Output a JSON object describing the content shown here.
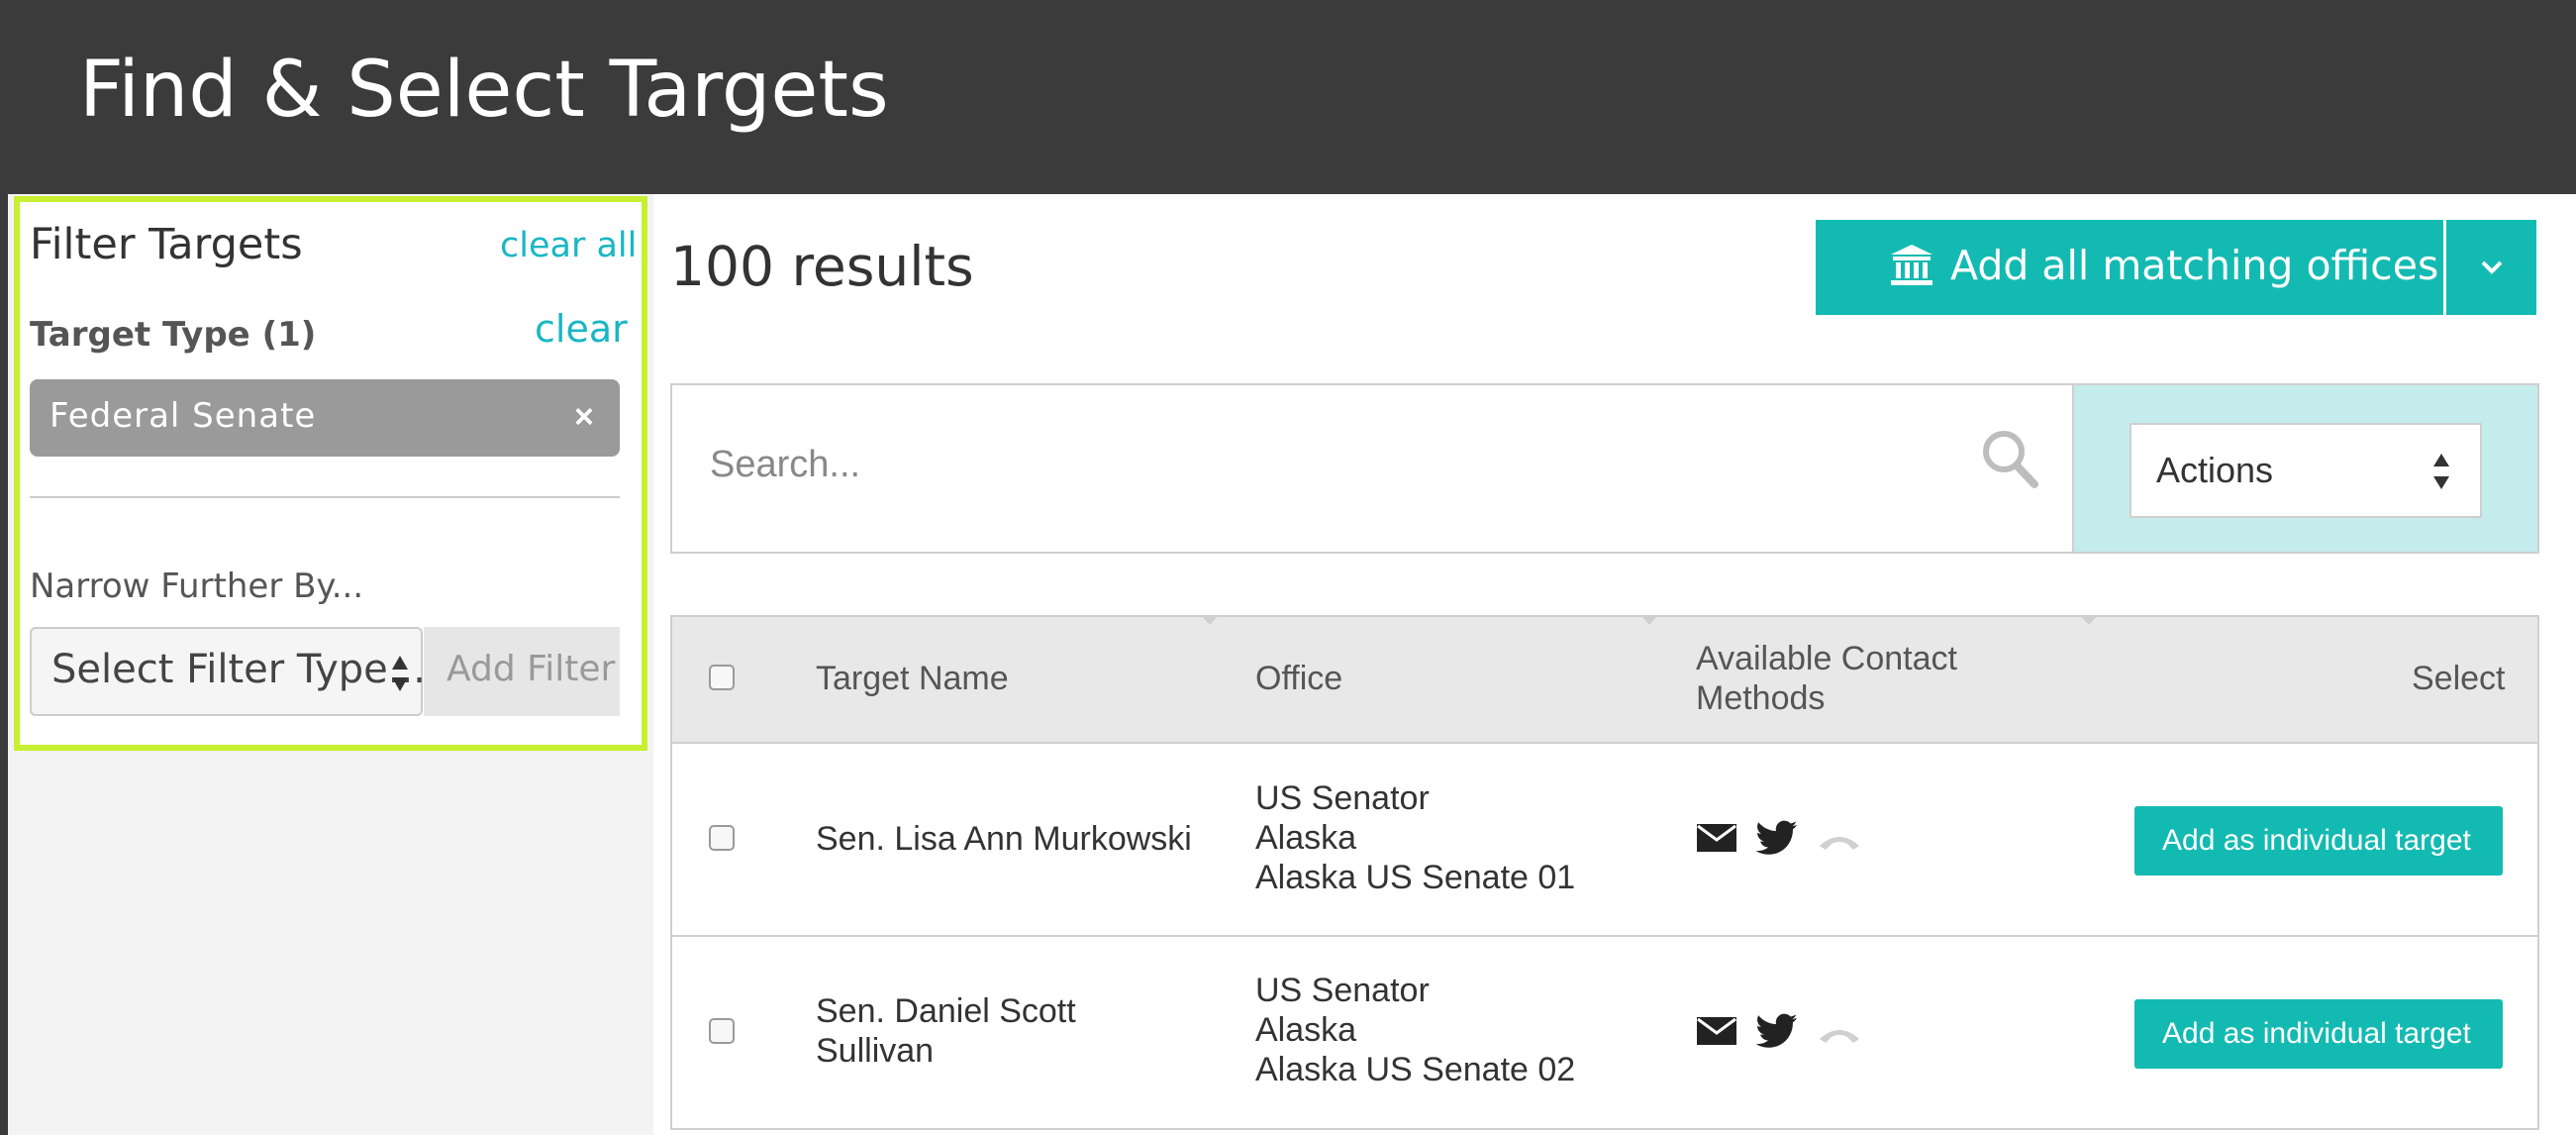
{
  "header": {
    "title": "Find & Select Targets"
  },
  "filter_panel": {
    "title": "Filter Targets",
    "clear_all": "clear all",
    "target_type_label": "Target Type (1)",
    "clear": "clear",
    "chip_label": "Federal Senate",
    "chip_remove": "×",
    "narrow_label": "Narrow Further By...",
    "select_value": "Select Filter Type...",
    "add_filter": "Add Filter"
  },
  "results": {
    "count_label": "100 results",
    "add_all_label": "Add all matching offices",
    "icon": "bank-icon"
  },
  "search": {
    "placeholder": "Search..."
  },
  "actions": {
    "label": "Actions"
  },
  "table": {
    "headers": {
      "name": "Target Name",
      "office": "Office",
      "contact_line1": "Available Contact",
      "contact_line2": "Methods",
      "select": "Select"
    },
    "rows": [
      {
        "name_line1": "Sen. Lisa Ann Murkowski",
        "name_line2": "",
        "office_line1": "US Senator",
        "office_line2": "Alaska",
        "office_line3": "Alaska US Senate 01",
        "button": "Add as individual target"
      },
      {
        "name_line1": "Sen. Daniel Scott",
        "name_line2": "Sullivan",
        "office_line1": "US Senator",
        "office_line2": "Alaska",
        "office_line3": "Alaska US Senate 02",
        "button": "Add as individual target"
      }
    ]
  },
  "colors": {
    "header_bg": "#3b3b3b",
    "accent": "#13bab2",
    "link": "#19b6c4",
    "highlight_border": "#c6f031",
    "actions_bg": "#c5ecec",
    "chip_bg": "#9a9a9a"
  }
}
